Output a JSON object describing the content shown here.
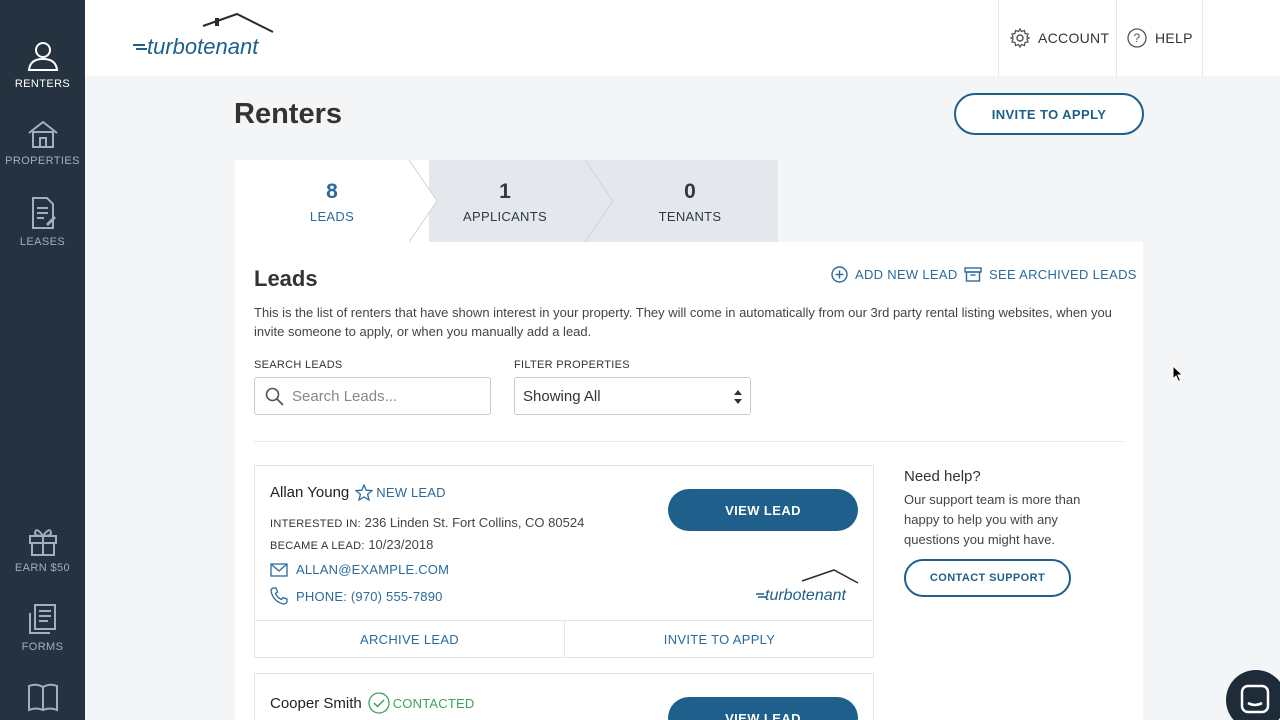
{
  "sidebar": {
    "items": [
      {
        "label": "RENTERS",
        "icon": "renters-icon",
        "active": true
      },
      {
        "label": "PROPERTIES",
        "icon": "house-icon",
        "active": false
      },
      {
        "label": "LEASES",
        "icon": "document-icon",
        "active": false
      },
      {
        "label": "EARN $50",
        "icon": "gift-icon",
        "active": false
      },
      {
        "label": "FORMS",
        "icon": "forms-icon",
        "active": false
      }
    ]
  },
  "header": {
    "logo_text": "turbotenant",
    "account_label": "ACCOUNT",
    "help_label": "HELP"
  },
  "page": {
    "title": "Renters",
    "invite_label": "INVITE TO APPLY"
  },
  "tabs": [
    {
      "count": "8",
      "label": "LEADS",
      "active": true
    },
    {
      "count": "1",
      "label": "APPLICANTS",
      "active": false
    },
    {
      "count": "0",
      "label": "TENANTS",
      "active": false
    }
  ],
  "leads": {
    "title": "Leads",
    "add_new_label": "ADD NEW LEAD",
    "see_archived_label": "SEE ARCHIVED LEADS",
    "description": "This is the list of renters that have shown interest in your property. They will come in automatically from our 3rd party rental listing websites, when you invite someone to apply, or when you manually add a lead.",
    "search_label": "SEARCH LEADS",
    "search_placeholder": "Search Leads...",
    "filter_label": "FILTER PROPERTIES",
    "filter_value": "Showing All",
    "items": [
      {
        "name": "Allan Young",
        "status": "NEW LEAD",
        "interested_label": "INTERESTED IN:",
        "interested_value": "236 Linden St. Fort Collins, CO 80524",
        "became_label": "BECAME A LEAD:",
        "became_value": "10/23/2018",
        "email": "ALLAN@EXAMPLE.COM",
        "phone": "PHONE: (970) 555-7890",
        "view_label": "VIEW LEAD",
        "source_logo": "turbotenant",
        "archive_label": "ARCHIVE LEAD",
        "invite_label": "INVITE TO APPLY"
      },
      {
        "name": "Cooper Smith",
        "status": "CONTACTED",
        "view_label": "VIEW LEAD"
      }
    ]
  },
  "help": {
    "title": "Need help?",
    "text": "Our support team is more than happy to help you with any questions you might have.",
    "button_label": "CONTACT SUPPORT"
  },
  "colors": {
    "sidebar_bg": "#253341",
    "primary": "#1f5f8b",
    "link": "#2a6b9c",
    "contacted_green": "#3aa35b"
  }
}
